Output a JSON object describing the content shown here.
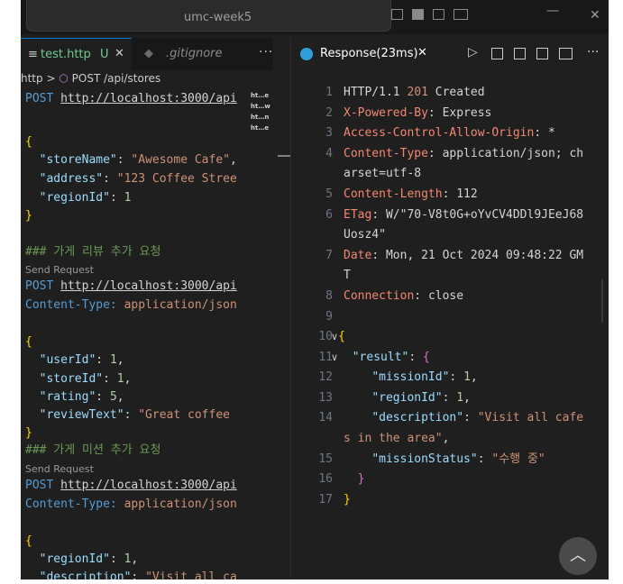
{
  "titlebar": {
    "search_text": "umc-week5",
    "close_label": "✕",
    "min_label": "—"
  },
  "left_editor": {
    "tabs": [
      {
        "label": "test.http",
        "badge": "U",
        "close": "✕",
        "active": true,
        "color": "#73c991"
      },
      {
        "label": ".gitignore",
        "active": false,
        "color": "#8b8b8b"
      }
    ],
    "more": "···",
    "breadcrumb": {
      "root": "http",
      "sep": ">",
      "method": "POST",
      "path": "/api/stores"
    },
    "lines": {
      "l1_method": "POST",
      "l1_url": "http://localhost:3000/api",
      "l2_brace": "{",
      "l3_key": "\"storeName\"",
      "l3_val": "\"Awesome Cafe\"",
      "l4_key": "\"address\"",
      "l4_val": "\"123 Coffee Stree",
      "l5_key": "\"regionId\"",
      "l5_val": "1",
      "l6_brace": "}",
      "l7_comment": "### 가게 리뷰 추가 요청",
      "l8_lens": "Send Request",
      "l9_method": "POST",
      "l9_url": "http://localhost:3000/api",
      "l10_header": "Content-Type:",
      "l10_val": "application/json",
      "l11_brace": "{",
      "l12_key": "\"userId\"",
      "l12_val": "1",
      "l13_key": "\"storeId\"",
      "l13_val": "1",
      "l14_key": "\"rating\"",
      "l14_val": "5",
      "l15_key": "\"reviewText\"",
      "l15_val": "\"Great coffee",
      "l16_brace": "}",
      "l17_comment": "### 가게 미션 추가 요청",
      "l18_lens": "Send Request",
      "l19_method": "POST",
      "l19_url": "http://localhost:3000/api",
      "l20_header": "Content-Type:",
      "l20_val": "application/json",
      "l21_brace": "{",
      "l22_key": "\"regionId\"",
      "l22_val": "1",
      "l23_key": "\"description\"",
      "l23_val": "\"Visit all ca"
    },
    "minimap": [
      "ht…e",
      "ht…w",
      "ht…n",
      "ht…e"
    ]
  },
  "right_editor": {
    "tab_title": "Response(23ms)",
    "tab_close": "✕",
    "line_numbers": [
      "1",
      "2",
      "3",
      "4",
      "5",
      "6",
      "7",
      "8",
      "9",
      "10",
      "11",
      "12",
      "13",
      "14",
      "15",
      "16",
      "17"
    ],
    "status": {
      "proto": "HTTP/1.1",
      "code": "201",
      "text": "Created"
    },
    "headers": [
      {
        "name": "X-Powered-By",
        "value": "Express"
      },
      {
        "name": "Access-Control-Allow-Origin",
        "value": "*"
      },
      {
        "name": "Content-Type",
        "value": "application/json; ch",
        "cont": "arset=utf-8"
      },
      {
        "name": "Content-Length",
        "value": "112"
      },
      {
        "name": "ETag",
        "value": "W/\"70-V8t0G+oYvCV4DDl9JEeJ68",
        "cont": "Uosz4\""
      },
      {
        "name": "Date",
        "value": "Mon, 21 Oct 2024 09:48:22 GM",
        "cont": "T"
      },
      {
        "name": "Connection",
        "value": "close"
      }
    ],
    "body": {
      "open": "{",
      "result_key": "\"result\"",
      "mission_key": "\"missionId\"",
      "mission_val": "1",
      "region_key": "\"regionId\"",
      "region_val": "1",
      "desc_key": "\"description\"",
      "desc_val": "\"Visit all cafe",
      "desc_cont": "s in the area\"",
      "status_key": "\"missionStatus\"",
      "status_val": "\"수행 중\"",
      "inner_close": "}",
      "close": "}"
    },
    "scroll_top_label": "︿"
  }
}
